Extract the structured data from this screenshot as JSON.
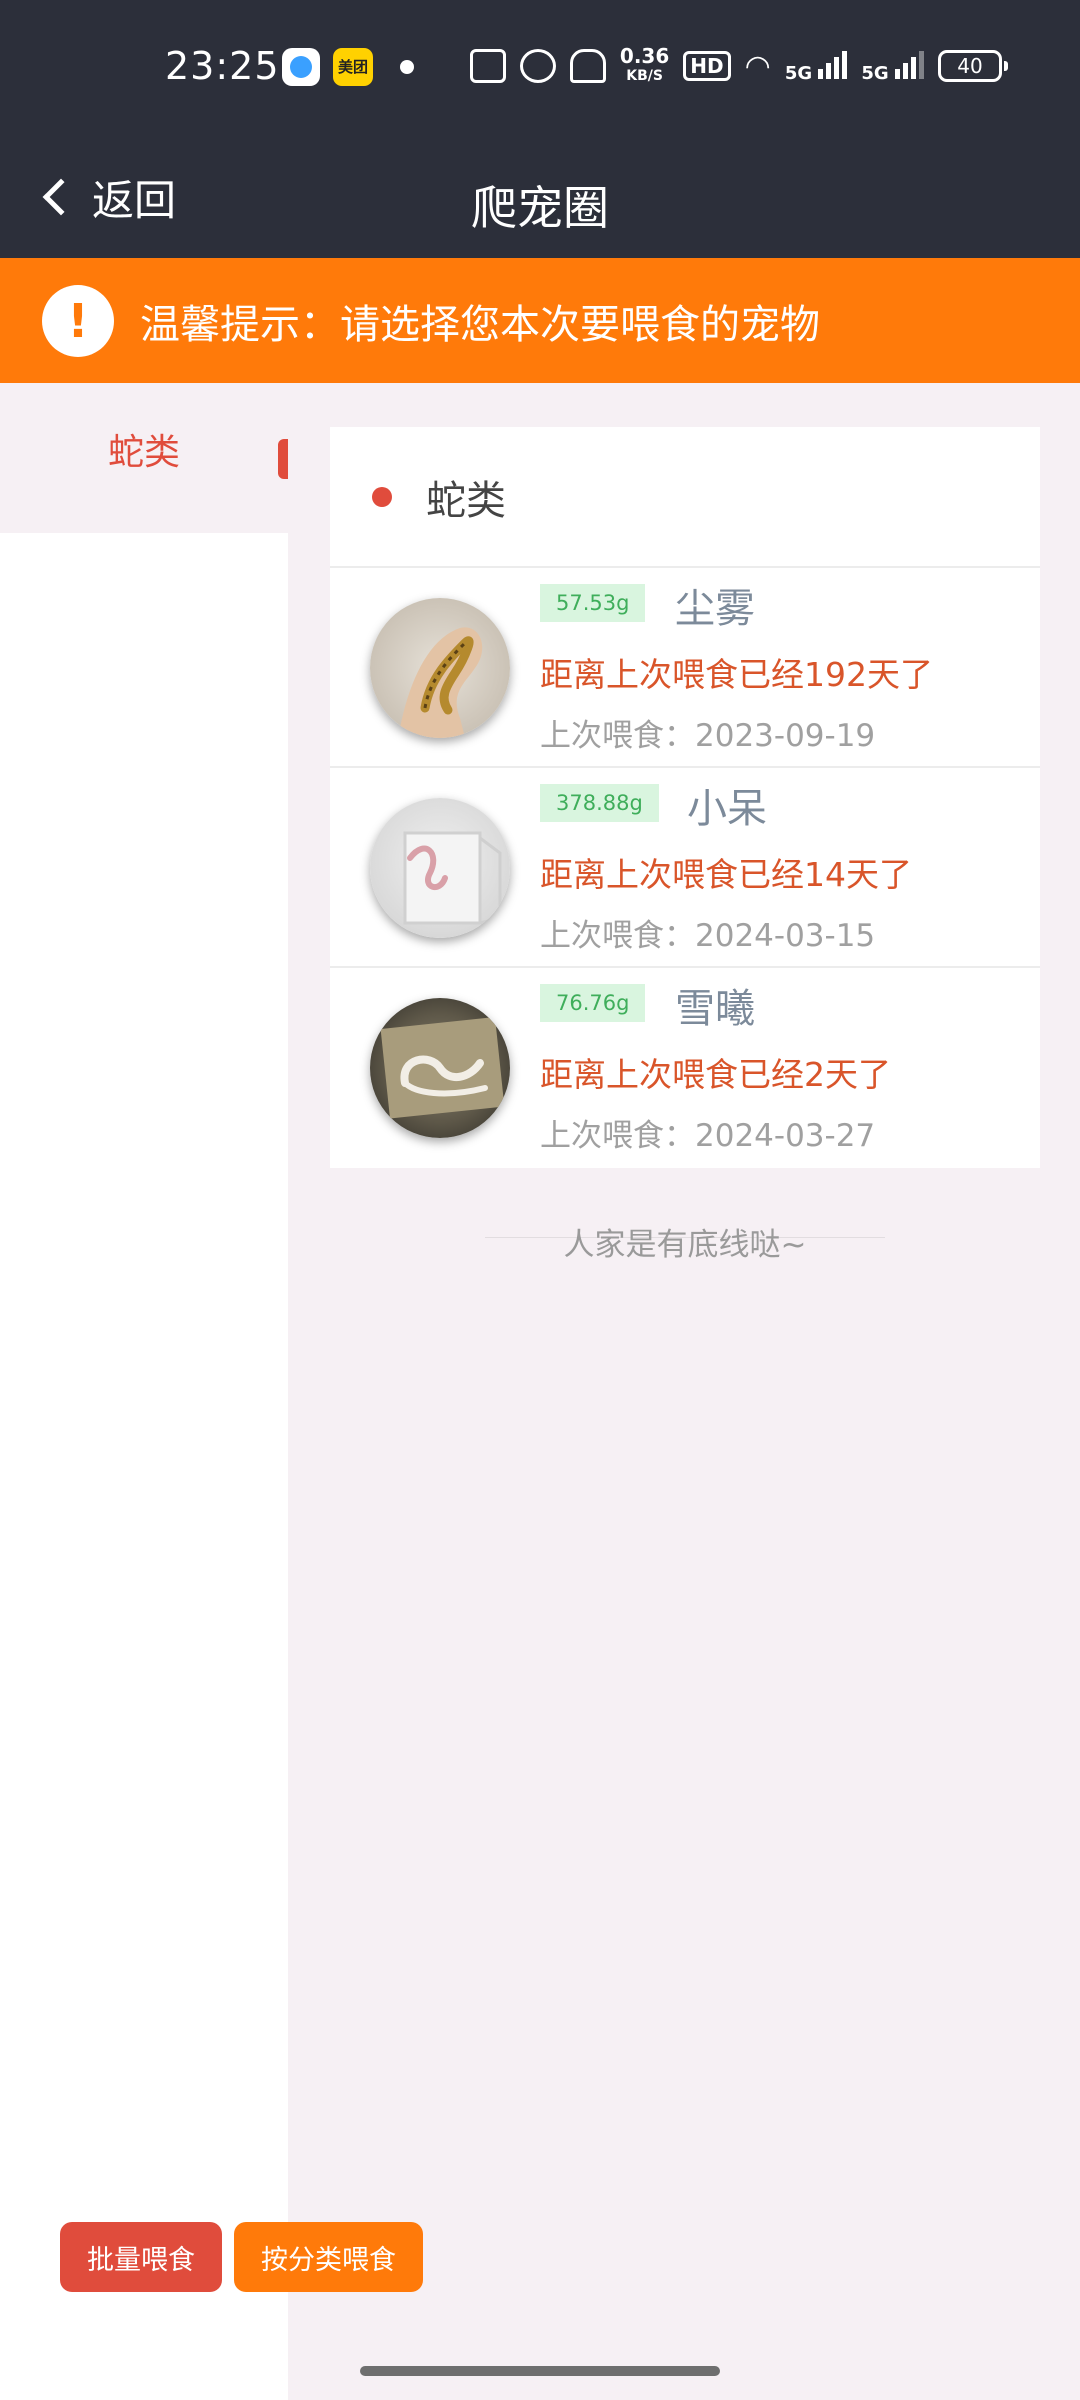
{
  "status_bar": {
    "time": "23:25",
    "app2_label": "美团",
    "net_speed_value": "0.36",
    "net_speed_unit": "KB/S",
    "hd_label": "HD",
    "sig1_label": "5G",
    "sig2_label": "5G",
    "battery": "40"
  },
  "nav": {
    "back_label": "返回",
    "title": "爬宠圈"
  },
  "tip": {
    "icon_glyph": "!",
    "text": "温馨提示：请选择您本次要喂食的宠物"
  },
  "sidebar": {
    "items": [
      {
        "label": "蛇类"
      }
    ]
  },
  "category": {
    "title": "蛇类"
  },
  "pets": [
    {
      "weight": "57.53g",
      "name": "尘雾",
      "since": "距离上次喂食已经192天了",
      "last_fed": "上次喂食：2023-09-19"
    },
    {
      "weight": "378.88g",
      "name": "小呆",
      "since": "距离上次喂食已经14天了",
      "last_fed": "上次喂食：2024-03-15"
    },
    {
      "weight": "76.76g",
      "name": "雪曦",
      "since": "距离上次喂食已经2天了",
      "last_fed": "上次喂食：2024-03-27"
    }
  ],
  "end_text": "人家是有底线哒~",
  "buttons": {
    "batch_feed": "批量喂食",
    "feed_by_category": "按分类喂食"
  },
  "colors": {
    "header_bg": "#2c2f3a",
    "tip_bg": "#ff7a0a",
    "accent_red": "#e04c3c",
    "since_text": "#d9552a",
    "weight_bg": "#d9f5df",
    "weight_text": "#3fae5b",
    "page_bg": "#f6f0f4"
  }
}
